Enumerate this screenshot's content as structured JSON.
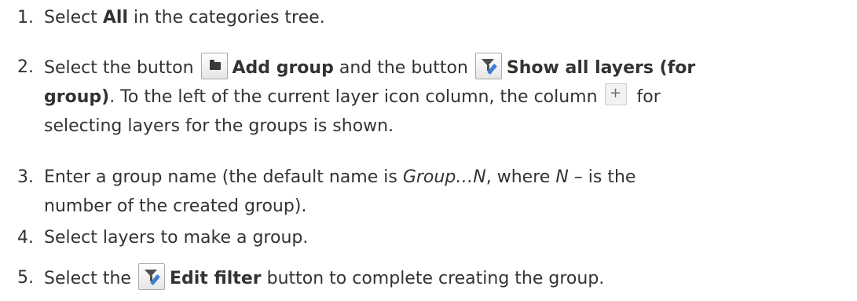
{
  "steps": [
    {
      "number": "1.",
      "parts": [
        "Select ",
        "All",
        " in the categories tree."
      ]
    },
    {
      "number": "2.",
      "t1": "Select the button ",
      "b1": "Add group",
      "t2": " and the button ",
      "b2": "Show all layers (for",
      "b3": "group)",
      "t3": ". To the left of the current layer icon column, the column ",
      "t4": " for",
      "t5": "selecting layers for the groups is shown."
    },
    {
      "number": "3.",
      "t1": "Enter a group name (the default name is ",
      "i1": "Group…N",
      "t2": ", where ",
      "i2": "N",
      "t3": " – is the",
      "t4": "number of the created group)."
    },
    {
      "number": "4.",
      "t1": "Select layers to make a group."
    },
    {
      "number": "5.",
      "t1": "Select the ",
      "b1": "Edit filter",
      "t2": " button to complete creating the group."
    }
  ],
  "icons": {
    "add_group": "folder-icon",
    "show_all_layers": "filter-edit-icon",
    "select_column": "plus-icon",
    "edit_filter": "filter-edit-icon"
  },
  "colors": {
    "text": "#333333",
    "pencil": "#3c7fd4"
  }
}
